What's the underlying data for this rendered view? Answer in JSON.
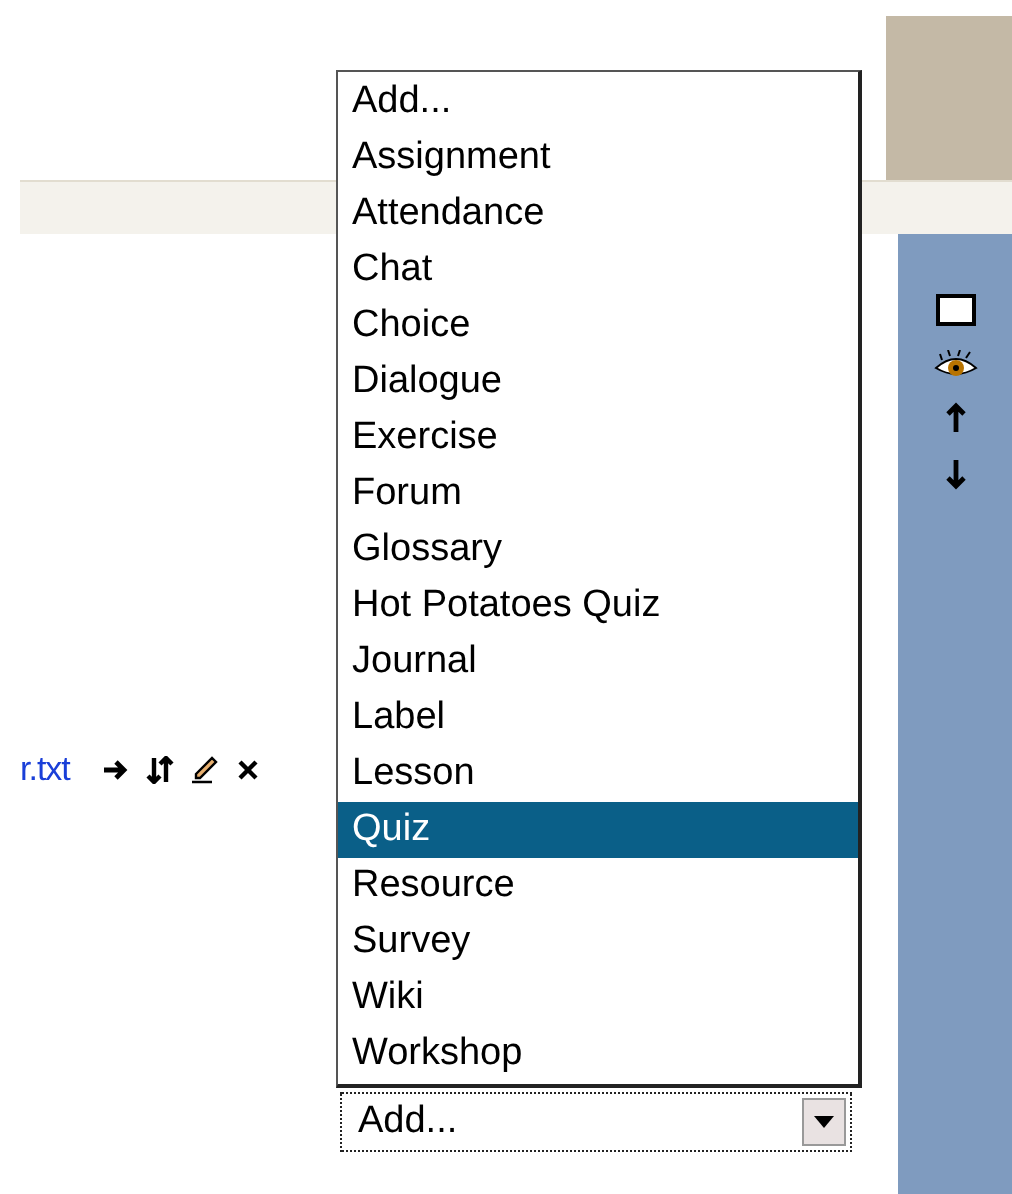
{
  "resource": {
    "link": "r.txt"
  },
  "activity_menu": {
    "items": [
      {
        "label": "Add...",
        "selected": false
      },
      {
        "label": "Assignment",
        "selected": false
      },
      {
        "label": "Attendance",
        "selected": false
      },
      {
        "label": "Chat",
        "selected": false
      },
      {
        "label": "Choice",
        "selected": false
      },
      {
        "label": "Dialogue",
        "selected": false
      },
      {
        "label": "Exercise",
        "selected": false
      },
      {
        "label": "Forum",
        "selected": false
      },
      {
        "label": "Glossary",
        "selected": false
      },
      {
        "label": "Hot Potatoes Quiz",
        "selected": false
      },
      {
        "label": "Journal",
        "selected": false
      },
      {
        "label": "Label",
        "selected": false
      },
      {
        "label": "Lesson",
        "selected": false
      },
      {
        "label": "Quiz",
        "selected": true
      },
      {
        "label": "Resource",
        "selected": false
      },
      {
        "label": "Survey",
        "selected": false
      },
      {
        "label": "Wiki",
        "selected": false
      },
      {
        "label": "Workshop",
        "selected": false
      }
    ]
  },
  "select": {
    "value": "Add..."
  }
}
